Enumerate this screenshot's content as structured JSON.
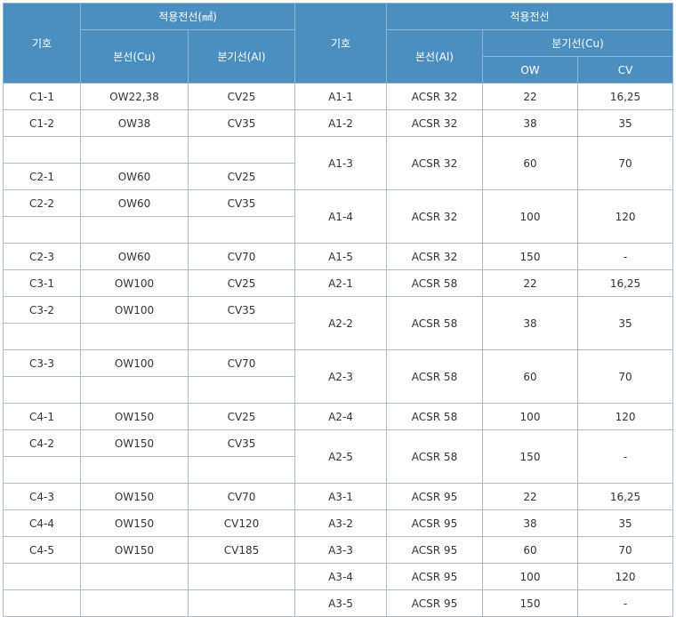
{
  "header": {
    "code": "기호",
    "applied_wire_cu": "적용전선(㎟)",
    "main_wire_cu": "본선(Cu)",
    "branch_wire_al": "분기선(Al)",
    "code2": "기호",
    "applied_wire": "적용전선",
    "main_wire_al": "본선(Al)",
    "branch_wire_cu": "분기선(Cu)",
    "ow": "OW",
    "cv": "CV"
  },
  "left_rows": [
    {
      "code": "C1-1",
      "main": "OW22,38",
      "branch": "CV25"
    },
    {
      "code": "C1-2",
      "main": "OW38",
      "branch": "CV35"
    },
    {
      "code": "",
      "main": "",
      "branch": ""
    },
    {
      "code": "C2-1",
      "main": "OW60",
      "branch": "CV25"
    },
    {
      "code": "C2-2",
      "main": "OW60",
      "branch": "CV35"
    },
    {
      "code": "",
      "main": "",
      "branch": ""
    },
    {
      "code": "C2-3",
      "main": "OW60",
      "branch": "CV70"
    },
    {
      "code": "C3-1",
      "main": "OW100",
      "branch": "CV25"
    },
    {
      "code": "C3-2",
      "main": "OW100",
      "branch": "CV35"
    },
    {
      "code": "",
      "main": "",
      "branch": ""
    },
    {
      "code": "C3-3",
      "main": "OW100",
      "branch": "CV70"
    },
    {
      "code": "",
      "main": "",
      "branch": ""
    },
    {
      "code": "C4-1",
      "main": "OW150",
      "branch": "CV25"
    },
    {
      "code": "C4-2",
      "main": "OW150",
      "branch": "CV35"
    },
    {
      "code": "",
      "main": "",
      "branch": ""
    },
    {
      "code": "C4-3",
      "main": "OW150",
      "branch": "CV70"
    },
    {
      "code": "C4-4",
      "main": "OW150",
      "branch": "CV120"
    },
    {
      "code": "C4-5",
      "main": "OW150",
      "branch": "CV185"
    },
    {
      "code": "",
      "main": "",
      "branch": ""
    },
    {
      "code": "",
      "main": "",
      "branch": ""
    }
  ],
  "right_rows": [
    {
      "code": "A1-1",
      "main": "ACSR 32",
      "ow": "22",
      "cv": "16,25"
    },
    {
      "code": "A1-2",
      "main": "ACSR 32",
      "ow": "38",
      "cv": "35"
    },
    {
      "code": "A1-3",
      "main": "ACSR 32",
      "ow": "60",
      "cv": "70"
    },
    {
      "code": "A1-4",
      "main": "ACSR 32",
      "ow": "100",
      "cv": "120"
    },
    {
      "code": "A1-5",
      "main": "ACSR 32",
      "ow": "150",
      "cv": "-"
    },
    {
      "code": "A2-1",
      "main": "ACSR 58",
      "ow": "22",
      "cv": "16,25"
    },
    {
      "code": "A2-2",
      "main": "ACSR 58",
      "ow": "38",
      "cv": "35"
    },
    {
      "code": "A2-3",
      "main": "ACSR 58",
      "ow": "60",
      "cv": "70"
    },
    {
      "code": "A2-4",
      "main": "ACSR 58",
      "ow": "100",
      "cv": "120"
    },
    {
      "code": "A2-5",
      "main": "ACSR 58",
      "ow": "150",
      "cv": "-"
    },
    {
      "code": "A3-1",
      "main": "ACSR 95",
      "ow": "22",
      "cv": "16,25"
    },
    {
      "code": "A3-2",
      "main": "ACSR 95",
      "ow": "38",
      "cv": "35"
    },
    {
      "code": "A3-3",
      "main": "ACSR 95",
      "ow": "60",
      "cv": "70"
    },
    {
      "code": "A3-4",
      "main": "ACSR 95",
      "ow": "100",
      "cv": "120"
    },
    {
      "code": "A3-5",
      "main": "ACSR 95",
      "ow": "150",
      "cv": "-"
    }
  ],
  "colors": {
    "header_bg": "#4b8ec0",
    "border": "#aebdcb",
    "text": "#333333"
  }
}
